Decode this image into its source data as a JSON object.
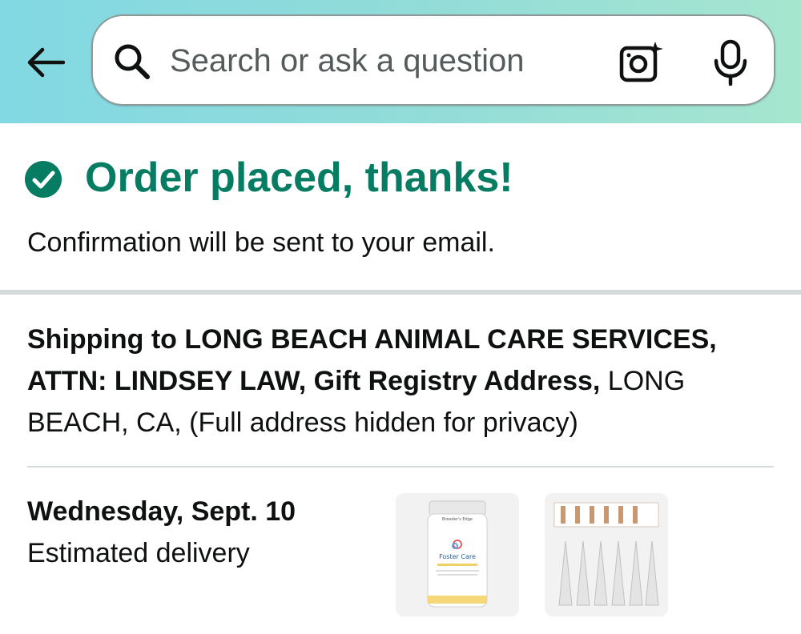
{
  "search": {
    "placeholder": "Search or ask a question"
  },
  "confirmation": {
    "title": "Order placed, thanks!",
    "subtitle": "Confirmation will be sent to your email."
  },
  "shipping": {
    "prefix_bold": "Shipping to LONG BEACH ANIMAL CARE SERVICES, ATTN: LINDSEY LAW, Gift Registry Address,",
    "address_rest": " LONG BEACH, CA, (Full address hidden for privacy)"
  },
  "delivery": {
    "date": "Wednesday, Sept. 10",
    "label": "Estimated delivery"
  },
  "products": [
    {
      "name": "Foster Care",
      "brand": "Breeder's Edge"
    },
    {
      "name": "",
      "brand": ""
    }
  ],
  "colors": {
    "success": "#067d62",
    "header_gradient_start": "#82d8e3",
    "header_gradient_end": "#a6e6cf"
  }
}
